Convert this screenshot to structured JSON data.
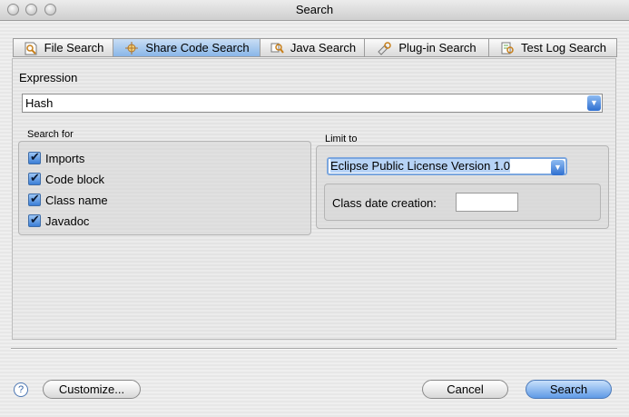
{
  "window": {
    "title": "Search"
  },
  "tabs": [
    {
      "label": "File Search",
      "icon": "file-search-icon"
    },
    {
      "label": "Share Code Search",
      "icon": "share-code-search-icon"
    },
    {
      "label": "Java Search",
      "icon": "java-search-icon"
    },
    {
      "label": "Plug-in Search",
      "icon": "plugin-search-icon"
    },
    {
      "label": "Test Log Search",
      "icon": "test-log-search-icon"
    }
  ],
  "expression": {
    "label": "Expression",
    "value": "Hash"
  },
  "search_for": {
    "label": "Search for",
    "options": [
      {
        "label": "Imports",
        "checked": true
      },
      {
        "label": "Code block",
        "checked": true
      },
      {
        "label": "Class name",
        "checked": true
      },
      {
        "label": "Javadoc",
        "checked": true
      }
    ]
  },
  "limit_to": {
    "label": "Limit to",
    "license_value": "Eclipse Public License Version 1.0",
    "class_date_label": "Class date creation:",
    "class_date_value": ""
  },
  "buttons": {
    "help": "?",
    "customize": "Customize...",
    "cancel": "Cancel",
    "search": "Search"
  },
  "colors": {
    "accent": "#5f9ae6",
    "selected_tab": "#89b6e8"
  }
}
